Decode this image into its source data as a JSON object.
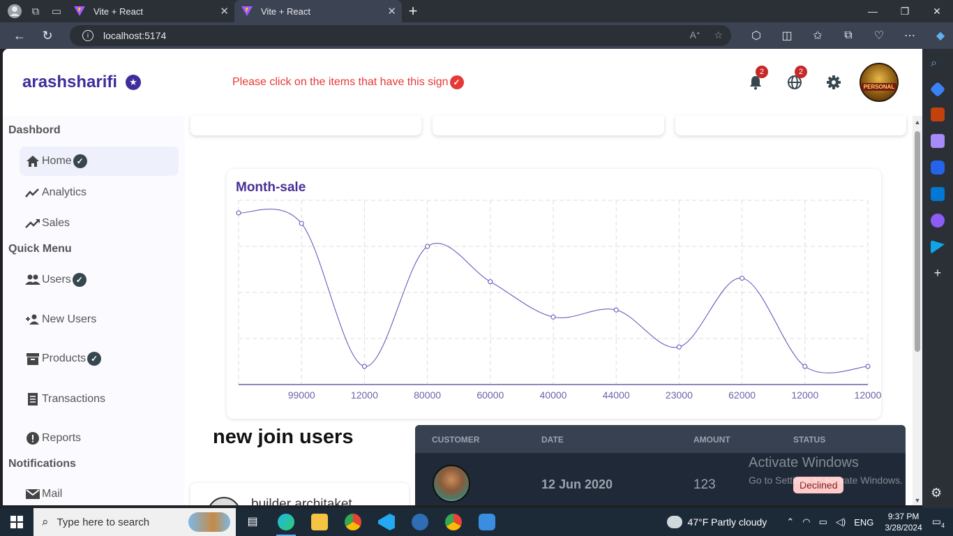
{
  "browser": {
    "tabs": [
      {
        "title": "Vite + React",
        "active": false
      },
      {
        "title": "Vite + React",
        "active": true
      }
    ],
    "url": "localhost:5174"
  },
  "header": {
    "brand": "arashsharifi",
    "hint": "Please click on the items that have this sign",
    "notifications_count": "2",
    "language_count": "2",
    "avatar_text": "PERSONAL"
  },
  "sidebar": {
    "sections": [
      {
        "title": "Dashbord"
      },
      {
        "title": "Quick Menu"
      },
      {
        "title": "Notifications"
      }
    ],
    "items": [
      {
        "label": "Home",
        "verified": true
      },
      {
        "label": "Analytics",
        "verified": false
      },
      {
        "label": "Sales",
        "verified": false
      },
      {
        "label": "Users",
        "verified": true
      },
      {
        "label": "New Users",
        "verified": false
      },
      {
        "label": "Products",
        "verified": true
      },
      {
        "label": "Transactions",
        "verified": false
      },
      {
        "label": "Reports",
        "verified": false
      },
      {
        "label": "Mail",
        "verified": false
      }
    ]
  },
  "chart_data": {
    "type": "line",
    "title": "Month-sale",
    "categories": [
      "",
      "99000",
      "12000",
      "80000",
      "60000",
      "40000",
      "44000",
      "23000",
      "62000",
      "12000",
      "12000"
    ],
    "series": [
      {
        "values": [
          99000,
          93000,
          12000,
          80000,
          60000,
          40000,
          44000,
          23000,
          62000,
          12000,
          12000
        ]
      }
    ],
    "ylim": [
      0,
      100000
    ],
    "grid": true,
    "color": "#5b4bb7"
  },
  "new_join": {
    "title": "new join users",
    "users": [
      {
        "name": "builder architaket"
      }
    ]
  },
  "transactions": {
    "headers": [
      "CUSTOMER",
      "DATE",
      "AMOUNT",
      "STATUS"
    ],
    "rows": [
      {
        "date": "12 Jun 2020",
        "amount": "123",
        "status": "Declined"
      }
    ]
  },
  "watermark": {
    "line1": "Activate Windows",
    "line2": "Go to Settings to activate Windows."
  },
  "taskbar": {
    "search_placeholder": "Type here to search",
    "weather": "47°F  Partly cloudy",
    "lang": "ENG",
    "time": "9:37 PM",
    "date": "3/28/2024",
    "notif_count": "4"
  }
}
